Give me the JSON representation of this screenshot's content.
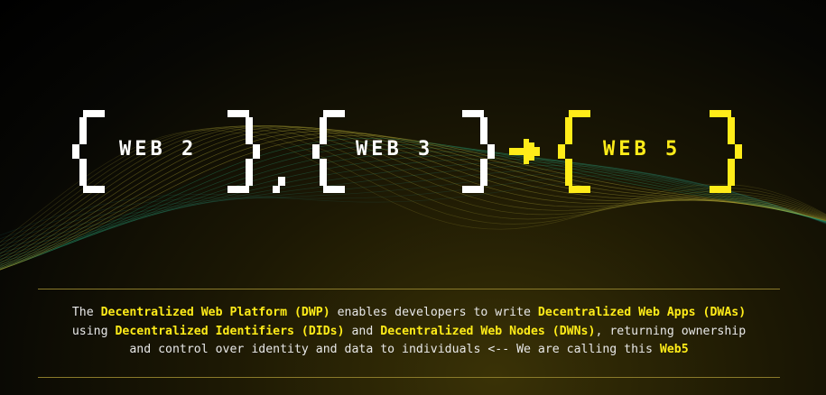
{
  "headline": {
    "web2": "WEB 2",
    "separator": ",",
    "web3": "WEB 3",
    "web5": "WEB 5"
  },
  "description": {
    "p1": "The ",
    "dwp": "Decentralized Web Platform (DWP)",
    "p2": " enables developers to write ",
    "dwa": "Decentralized Web Apps (DWAs)",
    "p3": "using ",
    "did": "Decentralized Identifiers (DIDs)",
    "p4": " and ",
    "dwn": "Decentralized Web Nodes (DWNs)",
    "p5": ", returning ownership",
    "p6": "and control over identity and data to individuals <-- We are calling this ",
    "web5": "Web5"
  },
  "colors": {
    "accent": "#ffec19",
    "text": "#ffffff",
    "background": "#000000"
  },
  "icons": {
    "arrow": "right-arrow-icon"
  }
}
